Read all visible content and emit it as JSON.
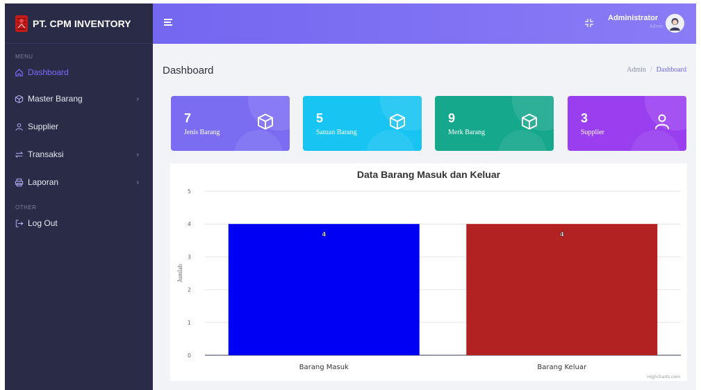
{
  "brand": {
    "name": "PT. CPM INVENTORY"
  },
  "sidebar": {
    "menu_label": "MENU",
    "other_label": "OTHER",
    "items": [
      {
        "label": "Dashboard",
        "icon": "home-icon"
      },
      {
        "label": "Master Barang",
        "icon": "box-icon",
        "chevron": "›"
      },
      {
        "label": "Supplier",
        "icon": "user-icon"
      },
      {
        "label": "Transaksi",
        "icon": "transfer-icon",
        "chevron": "›"
      },
      {
        "label": "Laporan",
        "icon": "printer-icon",
        "chevron": "›"
      }
    ],
    "logout": {
      "label": "Log Out",
      "icon": "logout-icon"
    }
  },
  "header": {
    "user_name": "Administrator",
    "user_role": "Admin"
  },
  "page": {
    "title": "Dashboard",
    "breadcrumb": [
      "Admin",
      "/",
      "Dashboard"
    ]
  },
  "cards": [
    {
      "value": "7",
      "label": "Jenis Barang",
      "color": "#7b6df2",
      "icon": "box-icon"
    },
    {
      "value": "5",
      "label": "Satuan Barang",
      "color": "#18c4f2",
      "icon": "box-icon"
    },
    {
      "value": "9",
      "label": "Merk Barang",
      "color": "#16a88c",
      "icon": "box-icon"
    },
    {
      "value": "3",
      "label": "Supplier",
      "color": "#9a3ff0",
      "icon": "user-icon"
    }
  ],
  "chart_data": {
    "type": "bar",
    "title": "Data Barang Masuk dan Keluar",
    "ylabel": "Jumlah",
    "xlabel": "",
    "categories": [
      "Barang Masuk",
      "Barang Keluar"
    ],
    "values": [
      4,
      4
    ],
    "colors": [
      "#0000f5",
      "#b22222"
    ],
    "data_labels": [
      "4",
      "4"
    ],
    "ylim": [
      0,
      5
    ],
    "yticks": [
      "0",
      "1",
      "2",
      "3",
      "4",
      "5"
    ],
    "grid": true,
    "credits": "Highcharts.com"
  }
}
